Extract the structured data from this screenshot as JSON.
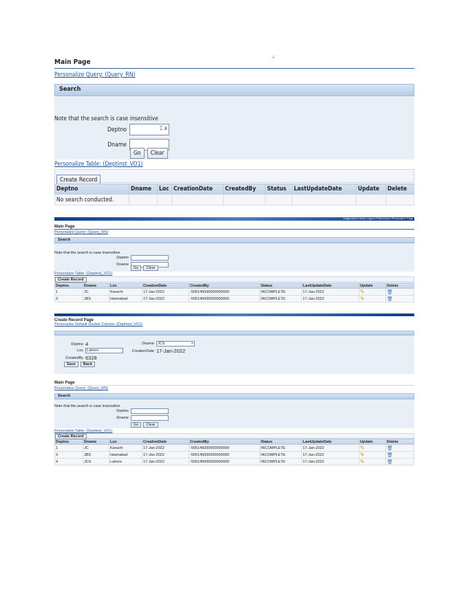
{
  "shot1": {
    "title": "Main Page",
    "personalize_query": "Personalize Query: (Query_RN)",
    "section": "Search",
    "note": "Note that the search is case insensitive",
    "deptno_label": "Deptno",
    "dname_label": "Dname",
    "go": "Go",
    "clear": "Clear",
    "personalize_table": "Personalize Table: (Deptinst_VO1)",
    "create_record": "Create Record",
    "columns": [
      "Deptno",
      "Dname",
      "Loc",
      "CreationDate",
      "CreatedBy",
      "Status",
      "LastUpdateDate",
      "Update",
      "Delete"
    ],
    "empty": "No search conducted."
  },
  "shot2": {
    "header_links": "Diagnostics  Home  Logout  Preferences  Personalize Page",
    "title": "Main Page",
    "personalize_query": "Personalize Query: (Query_RN)",
    "section": "Search",
    "note": "Note that the search is case insensitive",
    "deptno_label": "Deptno",
    "dname_label": "Dname",
    "go": "Go",
    "clear": "Clear",
    "personalize_table": "Personalize Table: (Deptinst_VO1)",
    "create_record": "Create Record",
    "columns": [
      "Deptno",
      "Dname",
      "Loc",
      "CreationDate",
      "CreatedBy",
      "Status",
      "LastUpdateDate",
      "Update",
      "Delete"
    ],
    "rows": [
      [
        "1",
        "JC",
        "Karachi",
        "17-Jan-2022",
        "-505145000000000000",
        "INCOMPLETE",
        "17-Jan-2022"
      ],
      [
        "3",
        "JBS",
        "Islamabad",
        "17-Jan-2022",
        "-505145000000000000",
        "INCOMPLETE",
        "17-Jan-2022"
      ]
    ]
  },
  "shot3": {
    "title": "Create Record Page",
    "personalize": "Personalize Default Double Column: (Deptinst_VO1)",
    "deptno_label": "Deptno",
    "deptno_value": "4",
    "dname_label": "Dname",
    "dname_value": "JCS",
    "loc_label": "Loc",
    "loc_value": "Lahore",
    "creationdate_label": "CreationDate",
    "creationdate_value": "17-Jan-2022",
    "createdby_label": "CreatedBy",
    "createdby_value": "6328",
    "save": "Save",
    "back": "Back"
  },
  "shot4": {
    "title": "Main Page",
    "personalize_query": "Personalize Query: (Query_RN)",
    "section": "Search",
    "note": "Note that the search is case insensitive",
    "deptno_label": "Deptno",
    "dname_label": "Dname",
    "go": "Go",
    "clear": "Clear",
    "personalize_table": "Personalize Table: (Deptinst_VO1)",
    "create_record": "Create Record",
    "columns": [
      "Deptno",
      "Dname",
      "Loc",
      "CreationDate",
      "CreatedBy",
      "Status",
      "LastUpdateDate",
      "Update",
      "Delete"
    ],
    "rows": [
      [
        "1",
        "JC",
        "Karachi",
        "17-Jan-2022",
        "-505145000000000000",
        "INCOMPLETE",
        "17-Jan-2022"
      ],
      [
        "3",
        "JBS",
        "Islamabad",
        "17-Jan-2022",
        "-505145000000000000",
        "INCOMPLETE",
        "17-Jan-2022"
      ],
      [
        "4",
        "JCS",
        "Lahore",
        "17-Jan-2022",
        "-505145000000000000",
        "INCOMPLETE",
        "17-Jan-2022"
      ]
    ]
  },
  "colors": {
    "accent": "#2a5e9c",
    "section_bg": "#c3d4e8",
    "link": "#1f4f96",
    "edit_icon": "#d99a10",
    "delete_icon": "#4a78b6"
  },
  "icons": {
    "edit": "pencil-icon",
    "delete": "trash-icon"
  }
}
